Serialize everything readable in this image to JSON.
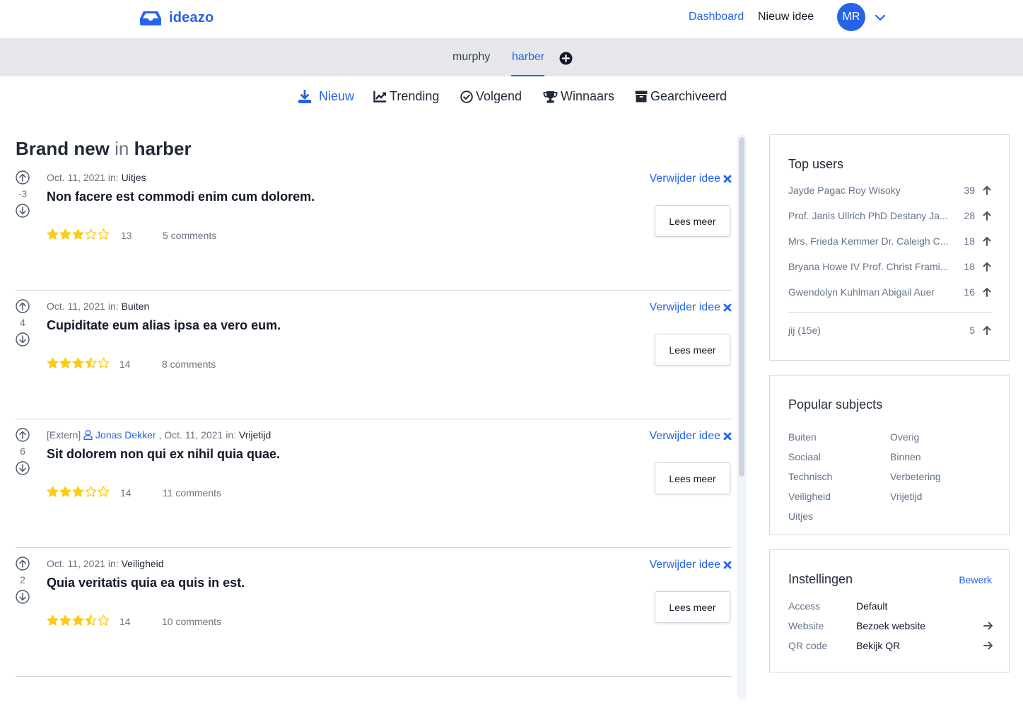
{
  "app": {
    "name": "ideazo",
    "brand_color": "#2563eb"
  },
  "topnav": {
    "dashboard": "Dashboard",
    "new_idea": "Nieuw idee",
    "avatar_initials": "MR"
  },
  "communities": {
    "items": [
      "murphy",
      "harber"
    ],
    "active": "harber"
  },
  "filters": [
    {
      "label": "Nieuw",
      "icon": "download-icon",
      "active": true
    },
    {
      "label": "Trending",
      "icon": "chart-line-icon",
      "active": false
    },
    {
      "label": "Volgend",
      "icon": "check-circle-icon",
      "active": false
    },
    {
      "label": "Winnaars",
      "icon": "trophy-icon",
      "active": false
    },
    {
      "label": "Gearchiveerd",
      "icon": "archive-icon",
      "active": false
    }
  ],
  "heading": {
    "prefix": "Brand new",
    "connector": "in",
    "community": "harber"
  },
  "ideas": [
    {
      "votes": "-3",
      "date": "Oct. 11, 2021",
      "in_label": "in:",
      "category": "Uitjes",
      "title": "Non facere est commodi enim cum dolorem.",
      "stars": 3,
      "rating_count": "13",
      "comments": "5 comments",
      "remove_label": "Verwijder idee",
      "read_label": "Lees meer"
    },
    {
      "votes": "4",
      "date": "Oct. 11, 2021",
      "in_label": "in:",
      "category": "Buiten",
      "title": "Cupiditate eum alias ipsa ea vero eum.",
      "stars": 3.5,
      "rating_count": "14",
      "comments": "8 comments",
      "remove_label": "Verwijder idee",
      "read_label": "Lees meer"
    },
    {
      "votes": "6",
      "external": "[Extern]",
      "author": "Jonas Dekker",
      "date": ", Oct. 11, 2021",
      "in_label": "in:",
      "category": "Vrijetijd",
      "title": "Sit dolorem non qui ex nihil quia quae.",
      "stars": 3,
      "rating_count": "14",
      "comments": "11 comments",
      "remove_label": "Verwijder idee",
      "read_label": "Lees meer"
    },
    {
      "votes": "2",
      "date": "Oct. 11, 2021",
      "in_label": "in:",
      "category": "Veiligheid",
      "title": "Quia veritatis quia ea quis in est.",
      "stars": 3.5,
      "rating_count": "14",
      "comments": "10 comments",
      "remove_label": "Verwijder idee",
      "read_label": "Lees meer"
    }
  ],
  "top_users": {
    "title": "Top users",
    "users": [
      {
        "name": "Jayde Pagac Roy Wisoky",
        "score": "39"
      },
      {
        "name": "Prof. Janis Ullrich PhD Destany Ja...",
        "score": "28"
      },
      {
        "name": "Mrs. Frieda Kemmer Dr. Caleigh C...",
        "score": "18"
      },
      {
        "name": "Bryana Howe IV Prof. Christ Frami...",
        "score": "18"
      },
      {
        "name": "Gwendolyn Kuhlman Abigail Auer",
        "score": "16"
      }
    ],
    "self": {
      "name": "jij (15e)",
      "score": "5"
    }
  },
  "popular_subjects": {
    "title": "Popular subjects",
    "left": [
      "Buiten",
      "Sociaal",
      "Technisch",
      "Veiligheid",
      "Uitjes"
    ],
    "right": [
      "Overig",
      "Binnen",
      "Verbetering",
      "Vrijetijd"
    ]
  },
  "settings": {
    "title": "Instellingen",
    "edit_label": "Bewerk",
    "rows": [
      {
        "label": "Access",
        "value": "Default"
      },
      {
        "label": "Website",
        "value": "Bezoek website"
      },
      {
        "label": "QR code",
        "value": "Bekijk QR"
      }
    ]
  },
  "colors": {
    "accent": "#2563eb",
    "star": "#facc15",
    "muted": "#64748b",
    "bar_bg": "#e5e7eb"
  }
}
